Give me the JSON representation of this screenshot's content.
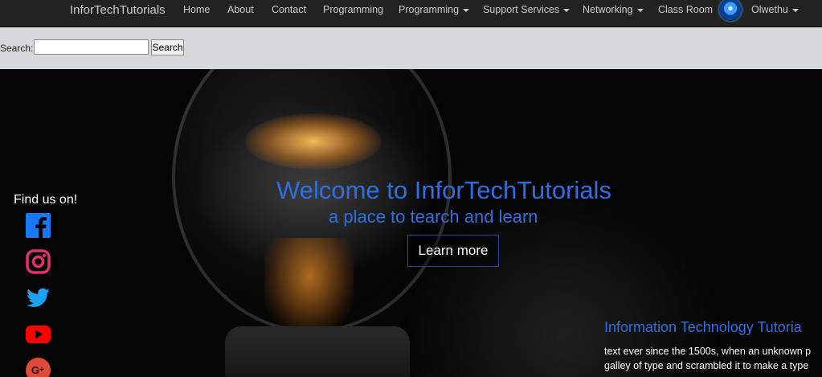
{
  "nav": {
    "brand": "InforTechTutorials",
    "items": [
      {
        "label": "Home"
      },
      {
        "label": "About"
      },
      {
        "label": "Contact"
      },
      {
        "label": "Programming"
      },
      {
        "label": "Programming"
      },
      {
        "label": "Support Services"
      },
      {
        "label": "Networking"
      },
      {
        "label": "Class Room"
      }
    ],
    "user": "Olwethu"
  },
  "search": {
    "label": "Search:",
    "value": "",
    "button": "Search"
  },
  "hero": {
    "title": "Welcome to InforTechTutorials",
    "subtitle": "a place to tearch and learn",
    "cta": "Learn more"
  },
  "social": {
    "heading": "Find us on!",
    "icons": [
      "facebook-icon",
      "instagram-icon",
      "twitter-icon",
      "youtube-icon",
      "google-plus-icon"
    ]
  },
  "info": {
    "title": "Information Technology Tutoria",
    "lines": [
      "text ever since the 1500s, when an unknown p",
      "galley of type and scrambled it to make a type"
    ]
  },
  "colors": {
    "nav_bg": "#222222",
    "search_bg": "#d6d9dc",
    "accent_blue": "#2f6fe0",
    "facebook": "#1877f2",
    "instagram": "#e1306c",
    "twitter": "#1da1f2",
    "youtube": "#ff0000",
    "google_plus": "#dd4b39"
  }
}
